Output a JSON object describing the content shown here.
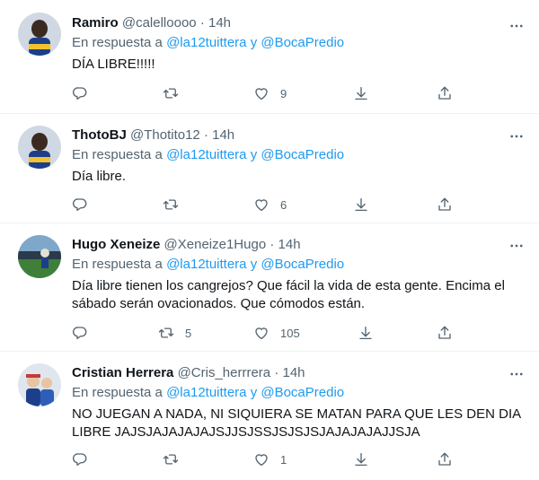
{
  "tweets": [
    {
      "name": "Ramiro",
      "handle": "@calelloooo",
      "time": "14h",
      "reply_prefix": "En respuesta a",
      "reply_to": "@la12tuittera y @BocaPredio",
      "lines": [
        "DÍA LIBRE!!!!!"
      ],
      "retweets": "",
      "likes": "9"
    },
    {
      "name": "ThotoBJ",
      "handle": "@Thotito12",
      "time": "14h",
      "reply_prefix": "En respuesta a",
      "reply_to": "@la12tuittera y @BocaPredio",
      "lines": [
        "Día libre."
      ],
      "retweets": "",
      "likes": "6"
    },
    {
      "name": "Hugo Xeneize",
      "handle": "@Xeneize1Hugo",
      "time": "14h",
      "reply_prefix": "En respuesta a",
      "reply_to": "@la12tuittera y @BocaPredio",
      "lines": [
        "Día libre tienen los cangrejos? Que fácil la vida de esta gente. Encima el",
        "sábado serán ovacionados. Que cómodos están."
      ],
      "retweets": "5",
      "likes": "105"
    },
    {
      "name": "Cristian Herrera",
      "handle": "@Cris_herrrera",
      "time": "14h",
      "reply_prefix": "En respuesta a",
      "reply_to": "@la12tuittera y @BocaPredio",
      "lines": [
        "NO JUEGAN A NADA, NI SIQUIERA SE MATAN PARA QUE LES DEN DIA",
        "LIBRE JAJSJAJAJAJAJSJJSJSSJSJSJSJAJAJAJAJJSJA"
      ],
      "retweets": "",
      "likes": "1"
    }
  ],
  "separator": "·",
  "colors": {
    "accent": "#1d9bf0",
    "muted": "#536471",
    "text": "#0f1419"
  }
}
